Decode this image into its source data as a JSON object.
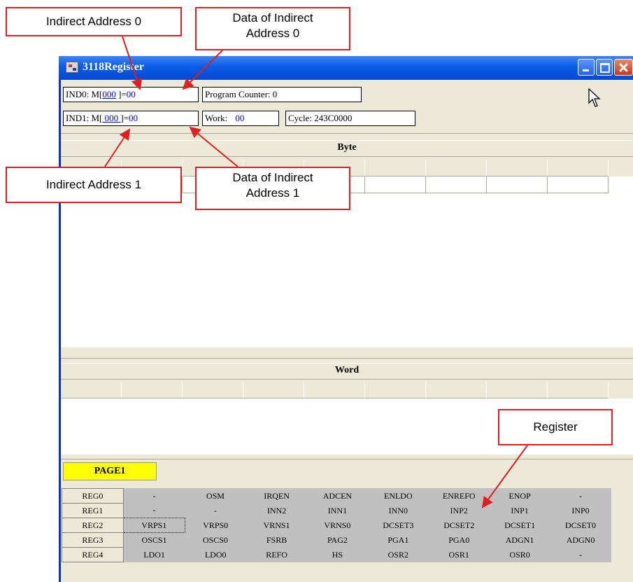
{
  "window": {
    "title": "3118Register",
    "ind0": {
      "prefix": "IND0: M[",
      "address": "000",
      "mid": " ]=",
      "data": "00"
    },
    "ind1": {
      "prefix": "IND1: M[",
      "address": " 000 ",
      "mid": "]=",
      "data": "00"
    },
    "program_counter": "Program Counter: 0",
    "work_label": "Work:",
    "work_value": "00",
    "cycle": "Cycle: 243C0000"
  },
  "byte_section": {
    "title": "Byte"
  },
  "word_section": {
    "title": "Word"
  },
  "register_page": {
    "tab_label": "PAGE1",
    "rows": [
      {
        "name": "REG0",
        "bits": [
          "-",
          "OSM",
          "IRQEN",
          "ADCEN",
          "ENLDO",
          "ENREFO",
          "ENOP",
          "-"
        ]
      },
      {
        "name": "REG1",
        "bits": [
          "-",
          "-",
          "INN2",
          "INN1",
          "INN0",
          "INP2",
          "INP1",
          "INP0"
        ]
      },
      {
        "name": "REG2",
        "bits": [
          "VRPS1",
          "VRPS0",
          "VRNS1",
          "VRNS0",
          "DCSET3",
          "DCSET2",
          "DCSET1",
          "DCSET0"
        ]
      },
      {
        "name": "REG3",
        "bits": [
          "OSCS1",
          "OSCS0",
          "FSRB",
          "PAG2",
          "PGA1",
          "PGA0",
          "ADGN1",
          "ADGN0"
        ]
      },
      {
        "name": "REG4",
        "bits": [
          "LDO1",
          "LDO0",
          "REFO",
          "HS",
          "OSR2",
          "OSR1",
          "OSR0",
          "-"
        ]
      }
    ]
  },
  "annotations": {
    "indirect_address_0": "Indirect Address 0",
    "data_indirect_0_line1": "Data of Indirect",
    "data_indirect_0_line2": "Address 0",
    "indirect_address_1": "Indirect Address 1",
    "data_indirect_1_line1": "Data of Indirect",
    "data_indirect_1_line2": "Address 1",
    "register": "Register"
  },
  "colors": {
    "title_bar": "#0a5ce6",
    "page_tab": "#ffff00",
    "annotation_border": "#e02020",
    "value_text": "#0000ff"
  }
}
